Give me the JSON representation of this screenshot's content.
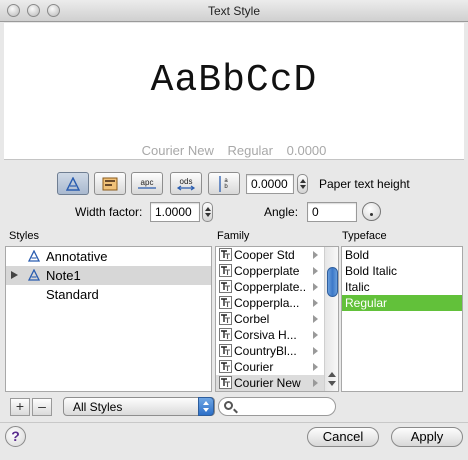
{
  "window": {
    "title": "Text Style"
  },
  "preview": {
    "sample_text": "AaBbCcD",
    "font_name": "Courier New",
    "font_style": "Regular",
    "font_size": "0.0000"
  },
  "toolbar": {
    "buttons": [
      {
        "icon": "annotative-icon",
        "active": true
      },
      {
        "icon": "background-mask-icon",
        "active": false
      },
      {
        "icon": "upside-down-icon",
        "label": "apc",
        "active": false
      },
      {
        "icon": "backwards-icon",
        "label": "ods",
        "active": false
      },
      {
        "icon": "vertical-text-icon",
        "active": false
      }
    ],
    "paper_height_value": "0.0000",
    "paper_height_label": "Paper text height",
    "width_factor_label": "Width factor:",
    "width_factor_value": "1.0000",
    "angle_label": "Angle:",
    "angle_value": "0"
  },
  "styles": {
    "header": "Styles",
    "items": [
      {
        "name": "Annotative",
        "annotative": true,
        "expandable": false,
        "selected": false
      },
      {
        "name": "Note1",
        "annotative": true,
        "expandable": true,
        "selected": true
      },
      {
        "name": "Standard",
        "annotative": false,
        "expandable": false,
        "selected": false
      }
    ],
    "add_label": "+",
    "remove_label": "–",
    "filter_value": "All Styles"
  },
  "family": {
    "header": "Family",
    "items": [
      "Cooper Std",
      "Copperplate",
      "Copperplate...",
      "Copperpla...",
      "Corbel",
      "Corsiva H...",
      "CountryBl...",
      "Courier",
      "Courier New"
    ],
    "selected_index": 8,
    "search_placeholder": ""
  },
  "typeface": {
    "header": "Typeface",
    "items": [
      "Bold",
      "Bold Italic",
      "Italic",
      "Regular"
    ],
    "selected_index": 3,
    "selected_color": "#62c13a"
  },
  "footer": {
    "help_label": "?",
    "cancel_label": "Cancel",
    "apply_label": "Apply"
  }
}
